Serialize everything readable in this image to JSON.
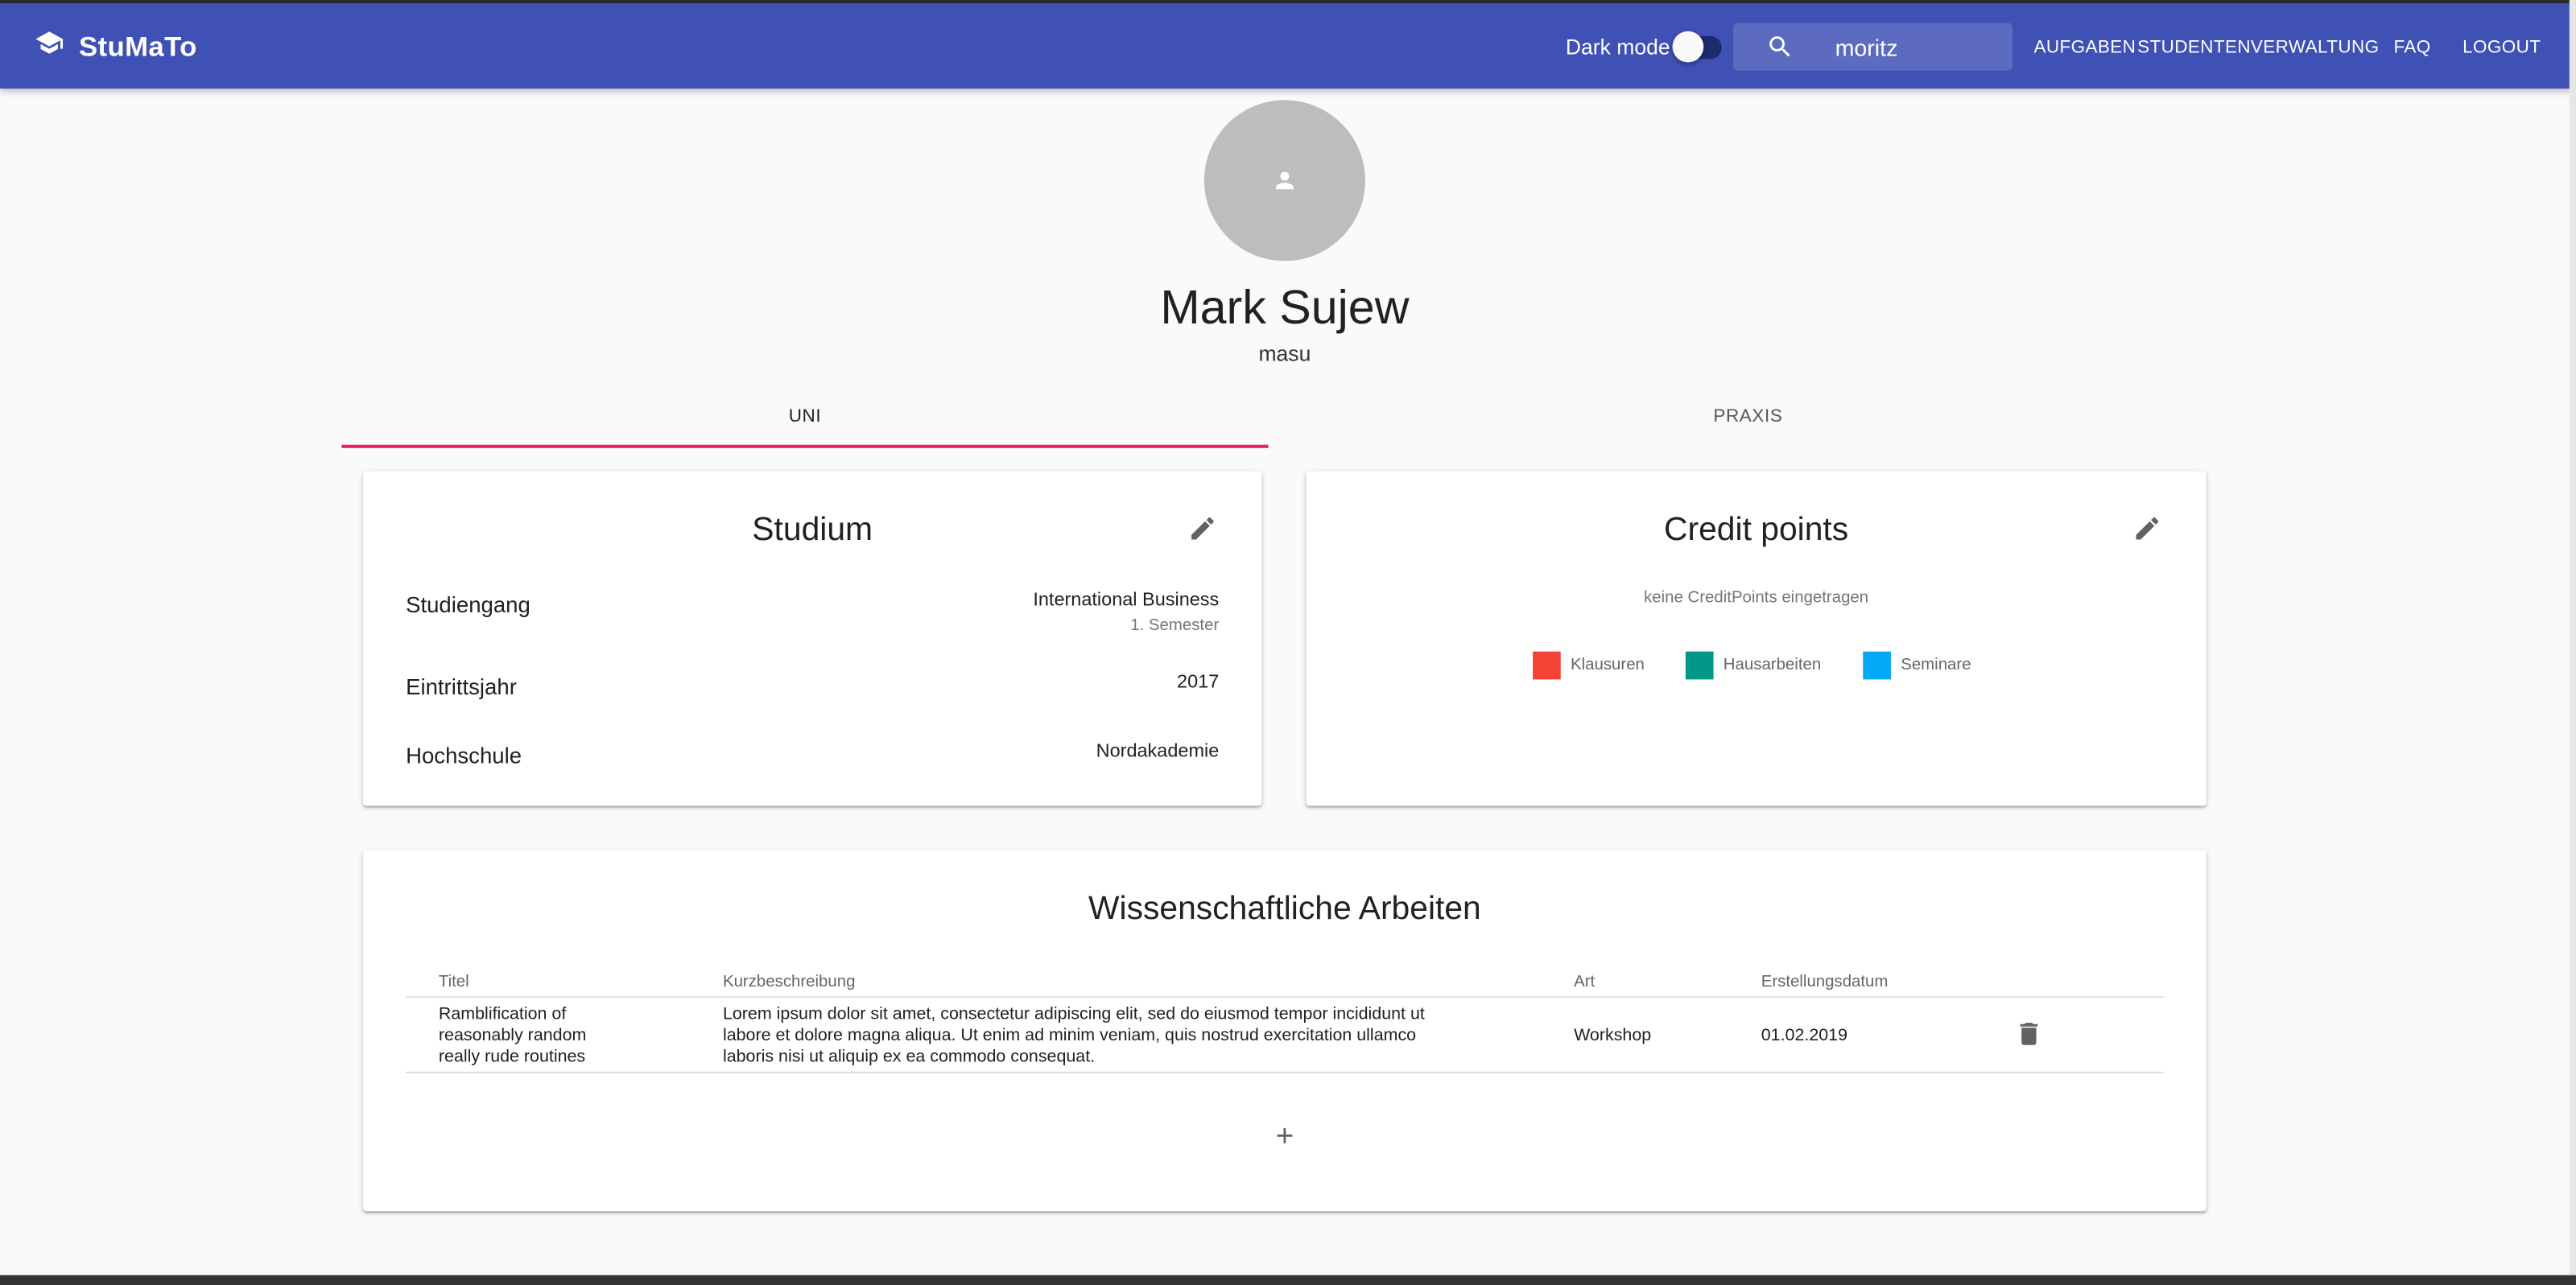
{
  "app": {
    "title": "StuMaTo"
  },
  "header": {
    "dark_mode_label": "Dark mode",
    "search_value": "moritz",
    "nav": [
      "AUFGABEN",
      "STUDENTEN",
      "VERWALTUNG",
      "FAQ",
      "LOGOUT"
    ]
  },
  "profile": {
    "name": "Mark Sujew",
    "username": "masu"
  },
  "tabs": [
    {
      "label": "UNI",
      "active": true
    },
    {
      "label": "PRAXIS",
      "active": false
    }
  ],
  "studium": {
    "title": "Studium",
    "rows": [
      {
        "label": "Studiengang",
        "value": "International Business",
        "sub": "1. Semester"
      },
      {
        "label": "Eintrittsjahr",
        "value": "2017"
      },
      {
        "label": "Hochschule",
        "value": "Nordakademie"
      }
    ]
  },
  "credit": {
    "title": "Credit points",
    "empty_text": "keine CreditPoints eingetragen",
    "legend": [
      {
        "label": "Klausuren",
        "color": "#f44336"
      },
      {
        "label": "Hausarbeiten",
        "color": "#009688"
      },
      {
        "label": "Seminare",
        "color": "#03a9f4"
      }
    ]
  },
  "arbeiten": {
    "title": "Wissenschaftliche Arbeiten",
    "columns": [
      "Titel",
      "Kurzbeschreibung",
      "Art",
      "Erstellungsdatum"
    ],
    "rows": [
      {
        "titel": [
          "Ramblification of",
          "reasonably random",
          "really rude routines"
        ],
        "kurz": [
          "Lorem ipsum dolor sit amet, consectetur adipiscing elit, sed do eiusmod tempor incididunt ut",
          "labore et dolore magna aliqua. Ut enim ad minim veniam, quis nostrud exercitation ullamco",
          "laboris nisi ut aliquip ex ea commodo consequat."
        ],
        "art": "Workshop",
        "datum": "01.02.2019"
      }
    ]
  },
  "colors": {
    "primary": "#3f51b5",
    "accent": "#e91e63",
    "background": "#fafafa"
  }
}
